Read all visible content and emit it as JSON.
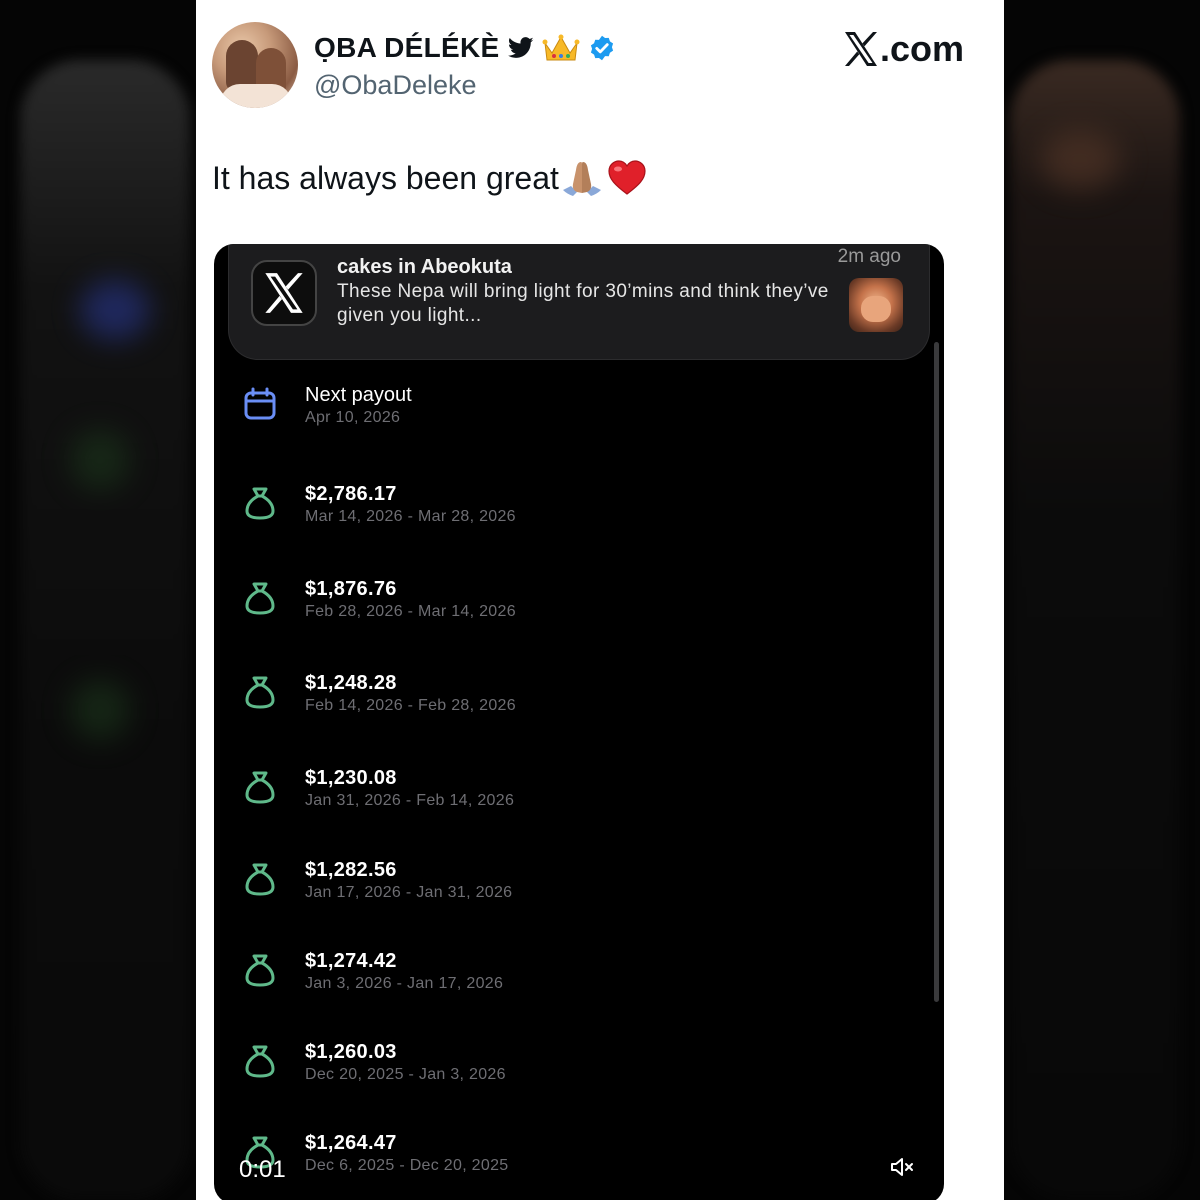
{
  "author": {
    "display_name": "ỌBA DÉLÉKÈ",
    "handle": "@ObaDeleke",
    "icons": [
      "bird-icon",
      "crown-icon",
      "verified-icon"
    ]
  },
  "brand": {
    "site": ".com",
    "icon": "x-logo"
  },
  "tweet": {
    "text": "It has always been great",
    "emojis": [
      "folded-hands",
      "red-heart"
    ]
  },
  "notification": {
    "title": "cakes in Abeokuta",
    "body": "These Nepa will bring light for 30’mins and think they’ve given you light...",
    "time": "2m ago"
  },
  "next_payout": {
    "label": "Next payout",
    "date": "Apr 10, 2026"
  },
  "payouts": [
    {
      "amount": "$2,786.17",
      "range": "Mar 14, 2026 - Mar 28, 2026"
    },
    {
      "amount": "$1,876.76",
      "range": "Feb 28, 2026 - Mar 14, 2026"
    },
    {
      "amount": "$1,248.28",
      "range": "Feb 14, 2026 - Feb 28, 2026"
    },
    {
      "amount": "$1,230.08",
      "range": "Jan 31, 2026 - Feb 14, 2026"
    },
    {
      "amount": "$1,282.56",
      "range": "Jan 17, 2026 - Jan 31, 2026"
    },
    {
      "amount": "$1,274.42",
      "range": "Jan 3, 2026 - Jan 17, 2026"
    },
    {
      "amount": "$1,260.03",
      "range": "Dec 20, 2025 - Jan 3, 2026"
    },
    {
      "amount": "$1,264.47",
      "range": "Dec 6, 2025 - Dec 20, 2025"
    }
  ],
  "video": {
    "timestamp": "0:01",
    "mute_icon": "muted-speaker-icon"
  },
  "colors": {
    "payout_icon": "#5fb98a",
    "calendar_icon": "#6a8ef5",
    "verified": "#1d9bf0",
    "heart": "#e0202a"
  }
}
